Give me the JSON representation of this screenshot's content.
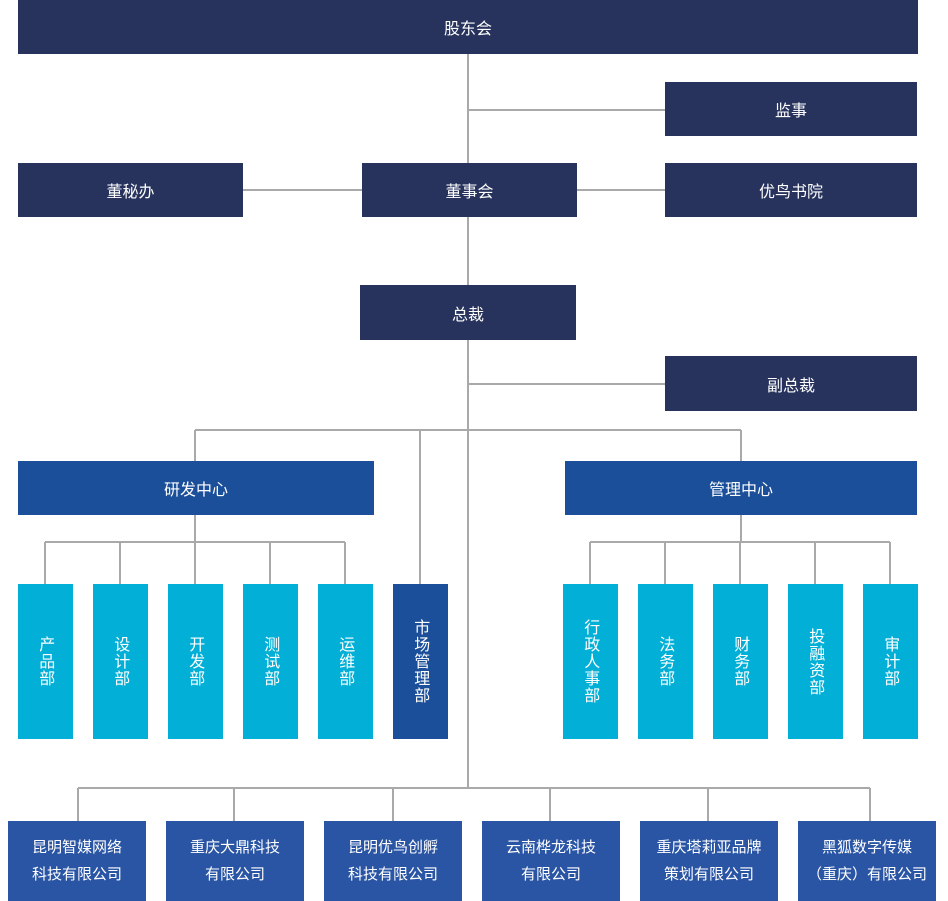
{
  "top": {
    "shareholders": "股东会",
    "supervisor": "监事",
    "board_secretary_office": "董秘办",
    "board": "董事会",
    "academy": "优鸟书院",
    "ceo": "总裁",
    "vice_president": "副总裁"
  },
  "centers": {
    "rd": "研发中心",
    "management": "管理中心"
  },
  "rd_departments": [
    "产品部",
    "设计部",
    "开发部",
    "测试部",
    "运维部"
  ],
  "market_department": "市场管理部",
  "management_departments": [
    "行政人事部",
    "法务部",
    "财务部",
    "投融资部",
    "审计部"
  ],
  "subsidiaries": [
    {
      "line1": "昆明智媒网络",
      "line2": "科技有限公司"
    },
    {
      "line1": "重庆大鼎科技",
      "line2": "有限公司"
    },
    {
      "line1": "昆明优鸟创孵",
      "line2": "科技有限公司"
    },
    {
      "line1": "云南桦龙科技",
      "line2": "有限公司"
    },
    {
      "line1": "重庆塔莉亚品牌",
      "line2": "策划有限公司"
    },
    {
      "line1": "黑狐数字传媒",
      "line2": "（重庆）有限公司"
    }
  ],
  "colors": {
    "dark_navy": "#27335d",
    "center_blue": "#1b4f99",
    "department_cyan": "#02afd6",
    "subsidiary_blue": "#2a55a4",
    "connector_gray": "#a9a9a9"
  }
}
